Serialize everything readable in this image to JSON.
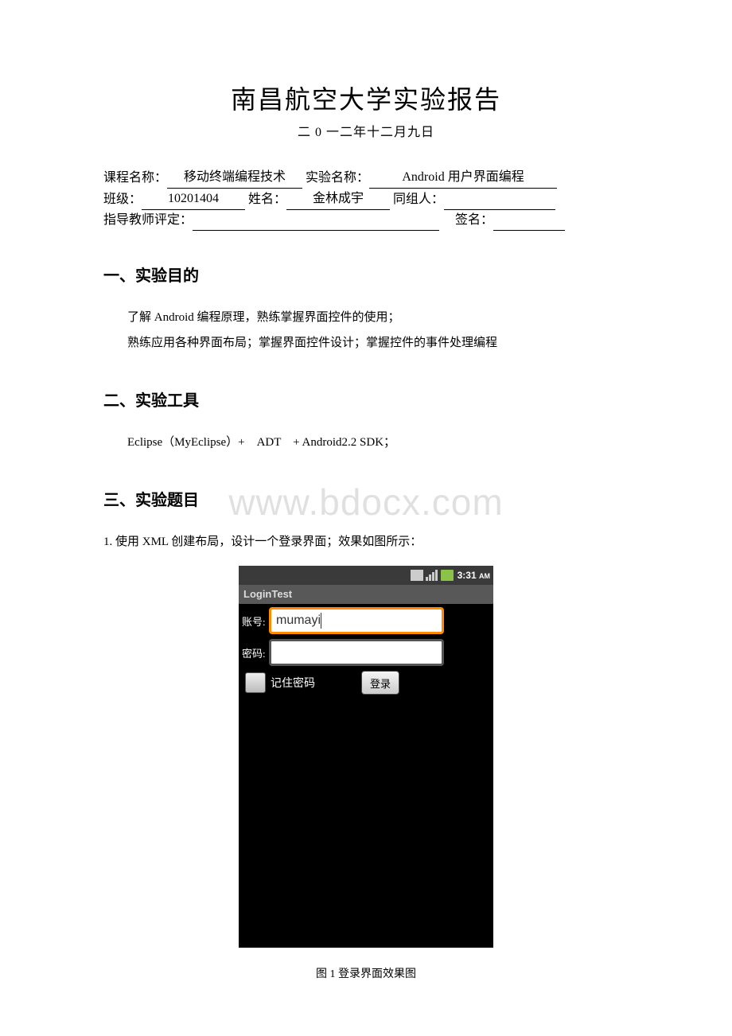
{
  "header": {
    "title": "南昌航空大学实验报告",
    "date": "二 0 一二年十二月九日"
  },
  "info": {
    "course_label": "课程名称：",
    "course_value": "移动终端编程技术",
    "exp_label": "实验名称：",
    "exp_value": "Android 用户界面编程",
    "class_label": "班级：",
    "class_value": "10201404",
    "name_label": "姓名：",
    "name_value": "金林成宇",
    "team_label": "同组人：",
    "team_value": "",
    "rating_label": "指导教师评定：",
    "rating_value": "",
    "sign_label": "签名：",
    "sign_value": ""
  },
  "sections": {
    "s1": {
      "heading": "一、实验目的",
      "p1": "了解 Android 编程原理，熟练掌握界面控件的使用；",
      "p2": "熟练应用各种界面布局；掌握界面控件设计；掌握控件的事件处理编程"
    },
    "s2": {
      "heading": "二、实验工具",
      "p1": "Eclipse（MyEclipse）+　ADT　+ Android2.2 SDK；"
    },
    "s3": {
      "heading": "三、实验题目",
      "p1": "1. 使用 XML 创建布局，设计一个登录界面；效果如图所示："
    }
  },
  "watermark": "www.bdocx.com",
  "phone": {
    "time": "3:31",
    "ampm": "AM",
    "app_title": "LoginTest",
    "account_label": "账号:",
    "account_value": "mumayi",
    "password_label": "密码:",
    "password_value": "",
    "remember_label": "记住密码",
    "login_button": "登录"
  },
  "caption": "图 1  登录界面效果图"
}
